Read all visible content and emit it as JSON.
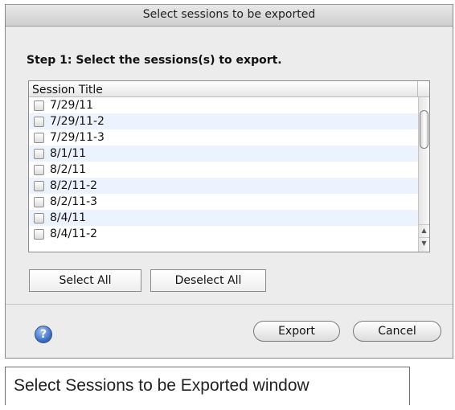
{
  "window": {
    "title": "Select sessions to be exported"
  },
  "step1": {
    "label": "Step 1: Select the sessions(s) to export."
  },
  "table": {
    "column_header": "Session Title",
    "rows": [
      {
        "title": "7/29/11",
        "checked": false
      },
      {
        "title": "7/29/11-2",
        "checked": false
      },
      {
        "title": "7/29/11-3",
        "checked": false
      },
      {
        "title": "8/1/11",
        "checked": false
      },
      {
        "title": "8/2/11",
        "checked": false
      },
      {
        "title": "8/2/11-2",
        "checked": false
      },
      {
        "title": "8/2/11-3",
        "checked": false
      },
      {
        "title": "8/4/11",
        "checked": false
      },
      {
        "title": "8/4/11-2",
        "checked": false
      }
    ]
  },
  "buttons": {
    "select_all": "Select All",
    "deselect_all": "Deselect All",
    "export": "Export",
    "cancel": "Cancel",
    "help": "?"
  },
  "icons": {
    "help": "help-icon",
    "scroll_up": "scroll-up-arrow-icon",
    "scroll_down": "scroll-down-arrow-icon"
  },
  "caption": "Select Sessions to be Exported window"
}
